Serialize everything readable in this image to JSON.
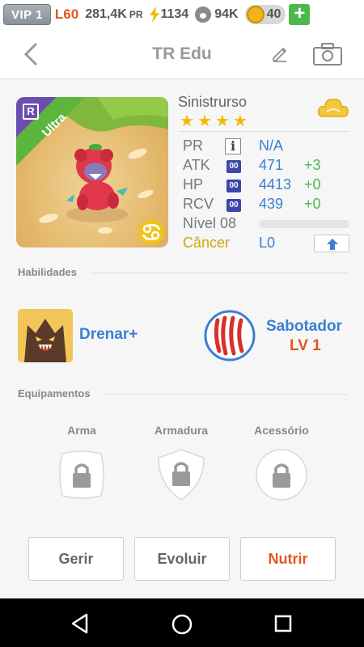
{
  "status_bar": {
    "vip": "VIP 1",
    "level": "L60",
    "pr": "281,4K",
    "pr_unit": "PR",
    "energy": "1134",
    "paws": "94K",
    "coins": "40",
    "plus_label": "+"
  },
  "header": {
    "title": "TR Edu"
  },
  "pet": {
    "name": "Sinistrurso",
    "rarity_letter": "R",
    "rarity_label": "Ultra",
    "stars": 4,
    "stats": [
      {
        "label": "PR",
        "value": "N/A",
        "bonus": "",
        "badge": "i"
      },
      {
        "label": "ATK",
        "value": "471",
        "bonus": "+3",
        "badge": "00"
      },
      {
        "label": "HP",
        "value": "4413",
        "bonus": "+0",
        "badge": "00"
      },
      {
        "label": "RCV",
        "value": "439",
        "bonus": "+0",
        "badge": "00"
      }
    ],
    "level_text": "Nível 08",
    "zodiac": "Câncer",
    "evolution": "L0",
    "xp_progress": 0
  },
  "skills": {
    "section_title": "Habilidades",
    "items": [
      {
        "name": "Drenar+"
      },
      {
        "name": "Sabotador",
        "level": "LV 1"
      }
    ]
  },
  "equipment": {
    "section_title": "Equipamentos",
    "slots": [
      {
        "label": "Arma",
        "icon": "lock-icon"
      },
      {
        "label": "Armadura",
        "icon": "lock-icon"
      },
      {
        "label": "Acessório",
        "icon": "lock-icon"
      }
    ]
  },
  "actions": {
    "manage": "Gerir",
    "evolve": "Evoluir",
    "nurture": "Nutrir"
  },
  "colors": {
    "accent_blue": "#3c7fd1",
    "accent_orange": "#e8541c",
    "bonus_green": "#4cb84c",
    "star_gold": "#f2b90a",
    "ultra_green": "#5cb63c"
  }
}
